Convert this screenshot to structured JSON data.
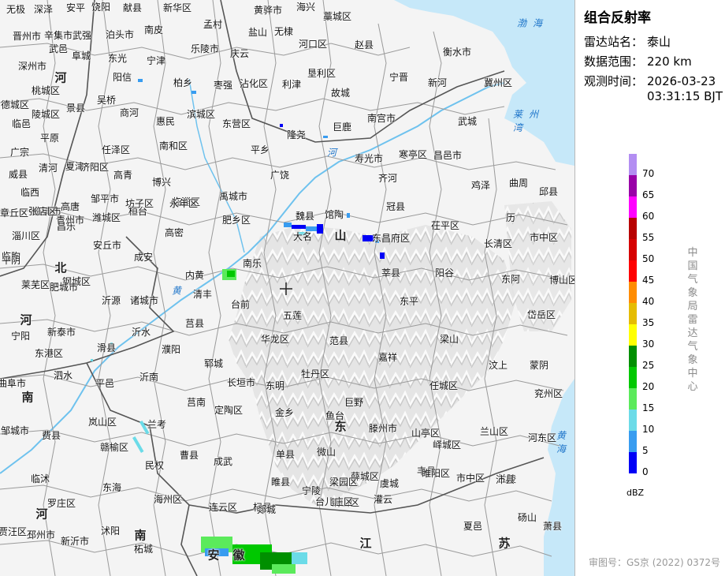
{
  "panel": {
    "title": "组合反射率",
    "station": {
      "label": "雷达站名：",
      "value": "泰山"
    },
    "range": {
      "label": "数据范围：",
      "value": "220 km"
    },
    "time": {
      "label": "观测时间：",
      "date": "2026-03-23",
      "clock": "03:31:15 BJT"
    },
    "legend_unit": "dBZ",
    "legend": [
      {
        "dbz": "70",
        "color": "#b38ef2"
      },
      {
        "dbz": "65",
        "color": "#9900a8"
      },
      {
        "dbz": "60",
        "color": "#ff00ff"
      },
      {
        "dbz": "55",
        "color": "#b80000"
      },
      {
        "dbz": "50",
        "color": "#d60000"
      },
      {
        "dbz": "45",
        "color": "#ff0000"
      },
      {
        "dbz": "40",
        "color": "#ff8c00"
      },
      {
        "dbz": "35",
        "color": "#e5bc00"
      },
      {
        "dbz": "30",
        "color": "#ffff00"
      },
      {
        "dbz": "25",
        "color": "#008f00"
      },
      {
        "dbz": "20",
        "color": "#00c800"
      },
      {
        "dbz": "15",
        "color": "#5bea5b"
      },
      {
        "dbz": "10",
        "color": "#6bdbe8"
      },
      {
        "dbz": "5",
        "color": "#389cf0"
      },
      {
        "dbz": "0",
        "color": "#0000f6"
      }
    ],
    "agency": "中国气象局雷达气象中心",
    "approval": "审图号：GS京 (2022) 0372号"
  },
  "colors": {
    "sea": "#c6e8f9",
    "river": "#6ec2ee",
    "boundary": "#8a8a8a",
    "terrain": "#e0e0e0"
  },
  "map": {
    "station_marker": "crosshair-icon",
    "places": [
      "无极",
      "深泽",
      "安平",
      "饶阳",
      "献县",
      "新华区",
      "黄骅市",
      "海兴",
      "藁城区",
      "晋州市",
      "辛集市",
      "武强",
      "泊头市",
      "南皮",
      "孟村",
      "盐山",
      "无棣",
      "河口区",
      "赵县",
      "衡水市",
      "深州市",
      "武邑",
      "阜城",
      "东光",
      "宁津",
      "乐陵市",
      "庆云",
      "沾化区",
      "利津",
      "垦利区",
      "宁晋",
      "新河",
      "冀州区",
      "桃城区",
      "景县",
      "吴桥",
      "阳信",
      "柏乡",
      "枣强",
      "故城",
      "德城区",
      "陵城区",
      "商河",
      "惠民",
      "滨城区",
      "东营区",
      "隆尧",
      "巨鹿",
      "南宫市",
      "武城",
      "临邑",
      "平原",
      "任泽区",
      "南和区",
      "平乡",
      "广宗",
      "威县",
      "清河",
      "夏津",
      "济阳区",
      "高青",
      "博兴",
      "广饶",
      "寿光市",
      "寒亭区",
      "昌邑市",
      "鸡泽",
      "曲周",
      "邱县",
      "临西",
      "临清市",
      "高唐",
      "邹平市",
      "桓台",
      "临淄区",
      "禹城市",
      "齐河",
      "章丘区",
      "张店区",
      "青州市",
      "潍城区",
      "坊子区",
      "永年区",
      "肥乡区",
      "馆陶",
      "冠县",
      "茌平区",
      "历",
      "市中区",
      "淄川区",
      "昌乐",
      "安丘市",
      "高密",
      "魏县",
      "大名",
      "东昌府区",
      "长清区",
      "博山区",
      "临朐",
      "莱芜区",
      "钢城区",
      "成安",
      "南乐",
      "莘县",
      "阳谷",
      "东阿",
      "平阴",
      "肥城市",
      "沂源",
      "诸城市",
      "内黄",
      "清丰",
      "台前",
      "东平",
      "岱岳区",
      "宁阳",
      "新泰市",
      "沂水",
      "莒县",
      "五莲",
      "华龙区",
      "范县",
      "梁山",
      "汶上",
      "蒙阴",
      "东港区",
      "滑县",
      "濮阳",
      "郓城",
      "嘉祥",
      "兖州区",
      "曲阜市",
      "泗水",
      "平邑",
      "沂南",
      "莒南",
      "长垣市",
      "东明",
      "牡丹区",
      "巨野",
      "任城区",
      "邹城市",
      "费县",
      "岚山区",
      "兰考",
      "定陶区",
      "金乡",
      "鱼台",
      "滕州市",
      "山亭区",
      "兰山区",
      "河东区",
      "临沭",
      "赣榆区",
      "民权",
      "曹县",
      "成武",
      "单县",
      "微山",
      "薛城区",
      "峄城区",
      "市中区",
      "兰陵",
      "罗庄区",
      "东海",
      "海州区",
      "连云区",
      "杞县",
      "睢县",
      "宁陵",
      "梁园区",
      "虞城",
      "丰县",
      "沛县",
      "铜山区",
      "台儿庄区",
      "郯城",
      "灌云",
      "睢阳区",
      "夏邑",
      "砀山",
      "萧县",
      "贾汪区",
      "邳州市",
      "新沂市",
      "沭阳",
      "柘城"
    ],
    "provinces": [
      "河",
      "北",
      "山",
      "河",
      "南",
      "东",
      "安",
      "徽",
      "江",
      "苏",
      "河",
      "南"
    ],
    "waters": [
      "渤海",
      "莱州湾",
      "黄海",
      "河",
      "黄"
    ]
  }
}
